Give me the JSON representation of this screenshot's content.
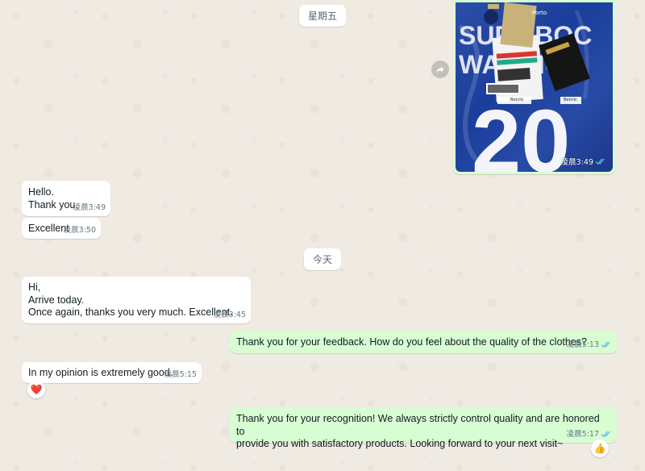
{
  "chat": {
    "date_chips": {
      "friday": "星期五",
      "today": "今天"
    },
    "image_message": {
      "jersey_brand": "Porto",
      "jersey_name_line1": "SUPA BOC",
      "jersey_name_line2": "WARRIO",
      "jersey_number": "20",
      "sponsor_tag": "Betclic",
      "time": "凌晨3:49",
      "status_icon": "double-check-read"
    },
    "messages": [
      {
        "direction": "incoming",
        "text": "Hello.\nThank you.",
        "time": "凌晨3:49"
      },
      {
        "direction": "incoming",
        "text": "Excellent",
        "time": "凌晨3:50"
      },
      {
        "direction": "incoming",
        "text": "Hi,\nArrive today.\nOnce again, thanks you very much. Excellent.",
        "time": "凌晨3:45"
      },
      {
        "direction": "outgoing",
        "text": "Thank you for your feedback. How do you feel about the quality of the clothes?",
        "time": "凌晨5:13",
        "status_icon": "double-check-read"
      },
      {
        "direction": "incoming",
        "text": "In my opinion is extremely good.",
        "time": "凌晨5:15",
        "reaction": "❤️"
      },
      {
        "direction": "outgoing",
        "text": "Thank you for your recognition! We always strictly control quality and are honored to\nprovide you with satisfactory products. Looking forward to your next visit~",
        "time": "凌晨5:17",
        "status_icon": "double-check-read",
        "reaction": "👍"
      }
    ]
  },
  "colors": {
    "background": "#efeae2",
    "incoming_bubble": "#ffffff",
    "outgoing_bubble": "#d9fdd3",
    "read_ticks": "#53bdeb",
    "timestamp": "#667781"
  }
}
